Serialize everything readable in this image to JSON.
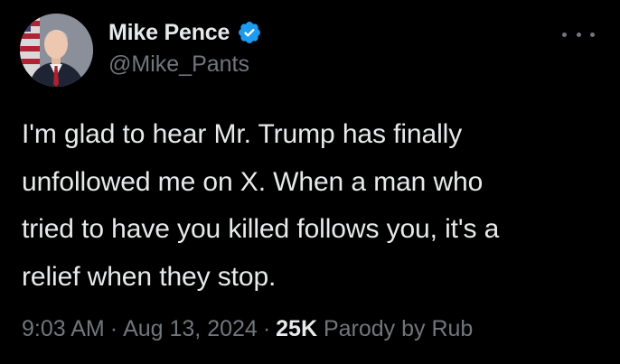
{
  "author": {
    "display_name": "Mike Pence",
    "handle": "@Mike_Pants",
    "verified_icon": "verified-badge-icon"
  },
  "menu": {
    "icon": "more-options-icon"
  },
  "tweet": {
    "lines": [
      "I'm glad to hear Mr. Trump has finally",
      "unfollowed me on X. When a man who",
      "tried to have you killed follows you, it's a",
      "relief when they stop."
    ]
  },
  "meta": {
    "time": "9:03 AM",
    "separator_1": "·",
    "date": "Aug 13, 2024",
    "separator_2": "·",
    "views": "25K",
    "label": "Parody by Rub"
  },
  "colors": {
    "background": "#000000",
    "primary_text": "#e7e9ea",
    "secondary_text": "#71767b",
    "verified_blue": "#1d9bf0"
  }
}
